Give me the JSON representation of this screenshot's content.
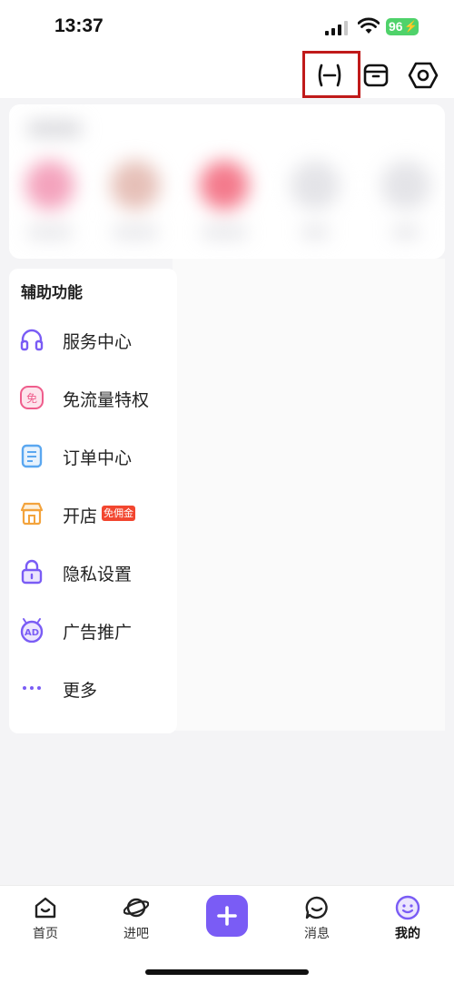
{
  "status_bar": {
    "time": "13:37",
    "battery": "96"
  },
  "toolbar": {
    "icons": [
      "scan-icon",
      "box-icon",
      "settings-icon"
    ]
  },
  "assist": {
    "title": "辅助功能",
    "items": [
      {
        "label": "服务中心",
        "icon": "headset-icon"
      },
      {
        "label": "免流量特权",
        "icon": "free-data-icon",
        "icon_text": "免"
      },
      {
        "label": "订单中心",
        "icon": "order-icon"
      },
      {
        "label": "开店",
        "icon": "shop-icon",
        "badge": "免佣金"
      },
      {
        "label": "隐私设置",
        "icon": "lock-icon"
      },
      {
        "label": "广告推广",
        "icon": "ad-icon",
        "icon_text": "AD"
      },
      {
        "label": "更多",
        "icon": "more-icon"
      }
    ]
  },
  "tabbar": {
    "tabs": [
      {
        "label": "首页"
      },
      {
        "label": "进吧"
      },
      {
        "label": "消息"
      },
      {
        "label": "我的"
      }
    ],
    "active": "我的"
  },
  "colors": {
    "accent": "#7a5cf5",
    "highlight": "#c01a1a",
    "badge": "#f2462f",
    "battery": "#4fd26a"
  }
}
